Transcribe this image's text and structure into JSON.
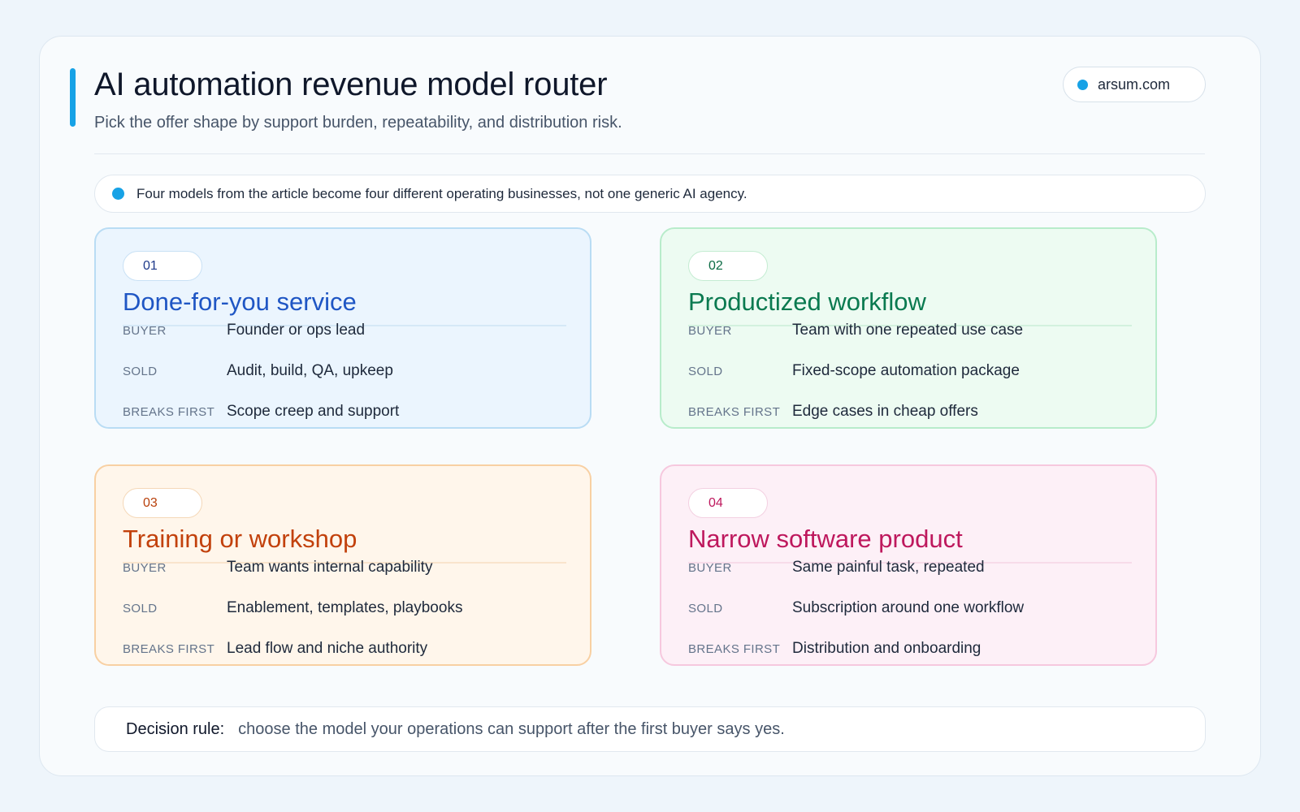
{
  "header": {
    "title": "AI automation revenue model router",
    "subtitle": "Pick the offer shape by support burden, repeatability, and distribution risk.",
    "site": "arsum.com"
  },
  "note": "Four models from the article become four different operating businesses, not one generic AI agency.",
  "row_labels": {
    "buyer": "BUYER",
    "sold": "SOLD",
    "breaks_first": "BREAKS FIRST"
  },
  "cards": [
    {
      "number": "01",
      "title": "Done-for-you service",
      "buyer": "Founder or ops lead",
      "sold": "Audit, build, QA, upkeep",
      "breaks_first": "Scope creep and support",
      "color": "#1f56c4"
    },
    {
      "number": "02",
      "title": "Productized workflow",
      "buyer": "Team with one repeated use case",
      "sold": "Fixed-scope automation package",
      "breaks_first": "Edge cases in cheap offers",
      "color": "#0a7a50"
    },
    {
      "number": "03",
      "title": "Training or workshop",
      "buyer": "Team wants internal capability",
      "sold": "Enablement, templates, playbooks",
      "breaks_first": "Lead flow and niche authority",
      "color": "#c2410c"
    },
    {
      "number": "04",
      "title": "Narrow software product",
      "buyer": "Same painful task, repeated",
      "sold": "Subscription around one workflow",
      "breaks_first": "Distribution and onboarding",
      "color": "#be185d"
    }
  ],
  "decision_rule": {
    "label": "Decision rule:",
    "text": "choose the model your operations can support after the first buyer says yes."
  },
  "colors": {
    "accent": "#17a2e6",
    "background": "#eef5fb"
  }
}
